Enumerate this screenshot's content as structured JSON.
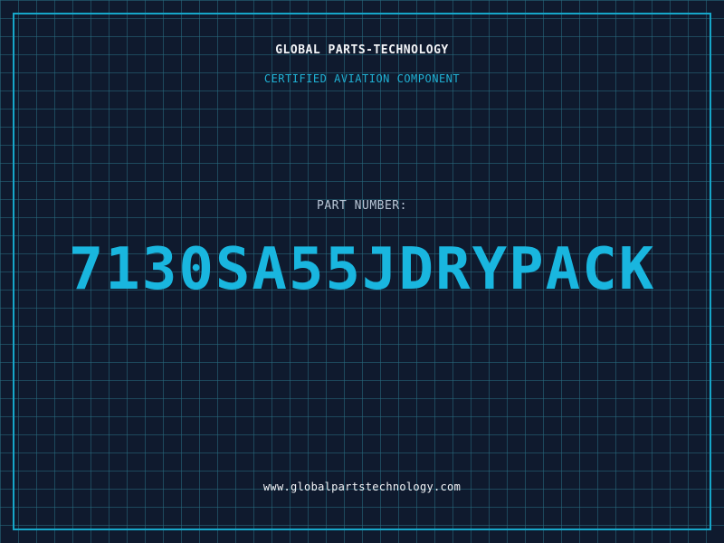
{
  "header": {
    "company": "GLOBAL PARTS-TECHNOLOGY",
    "tagline": "CERTIFIED AVIATION COMPONENT"
  },
  "part": {
    "label": "PART NUMBER:",
    "number": "7130SA55JDRYPACK"
  },
  "footer": {
    "website": "www.globalpartstechnology.com"
  },
  "colors": {
    "background": "#0f1a2e",
    "grid": "#286e82",
    "accent": "#16a6c9",
    "text": "#f2f4f7"
  }
}
